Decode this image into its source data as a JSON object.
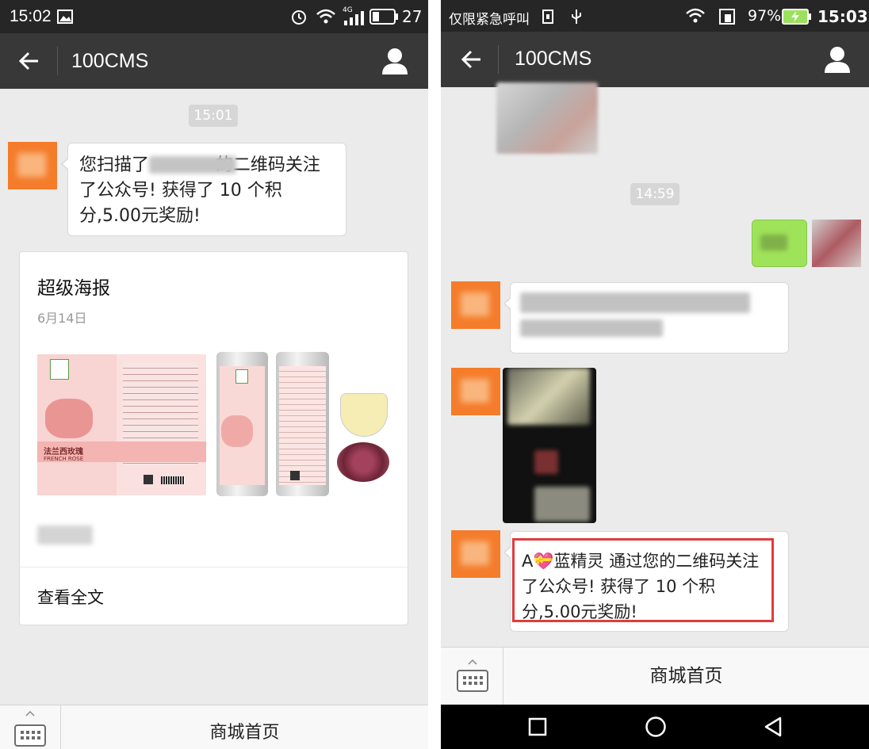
{
  "left": {
    "status": {
      "time": "15:02",
      "network": "4G",
      "battery": "27"
    },
    "header": {
      "title": "100CMS"
    },
    "timestamp": "15:01",
    "message": {
      "text": "您扫描了            的二维码关注了公众号! 获得了 10 个积分,5.00元奖励!"
    },
    "article": {
      "title": "超级海报",
      "date": "6月14日",
      "image_texts": {
        "brand_cn": "法兰西玫瑰",
        "brand_en": "FRENCH ROSE"
      },
      "read_more": "查看全文"
    },
    "bottom": {
      "menu_label": "商城首页"
    }
  },
  "right": {
    "status": {
      "carrier": "仅限紧急呼叫",
      "battery_pct": "97%",
      "time": "15:03"
    },
    "header": {
      "title": "100CMS"
    },
    "timestamp": "14:59",
    "message": {
      "text": "A💝蓝精灵 通过您的二维码关注了公众号! 获得了 10 个积分,5.00元奖励!"
    },
    "bottom": {
      "menu_label": "商城首页"
    }
  },
  "colors": {
    "status_bg": "#262626",
    "title_bg": "#383838",
    "chat_bg": "#ebebeb",
    "highlight": "#e03c3c",
    "outgoing_bubble": "#9fe35a"
  }
}
